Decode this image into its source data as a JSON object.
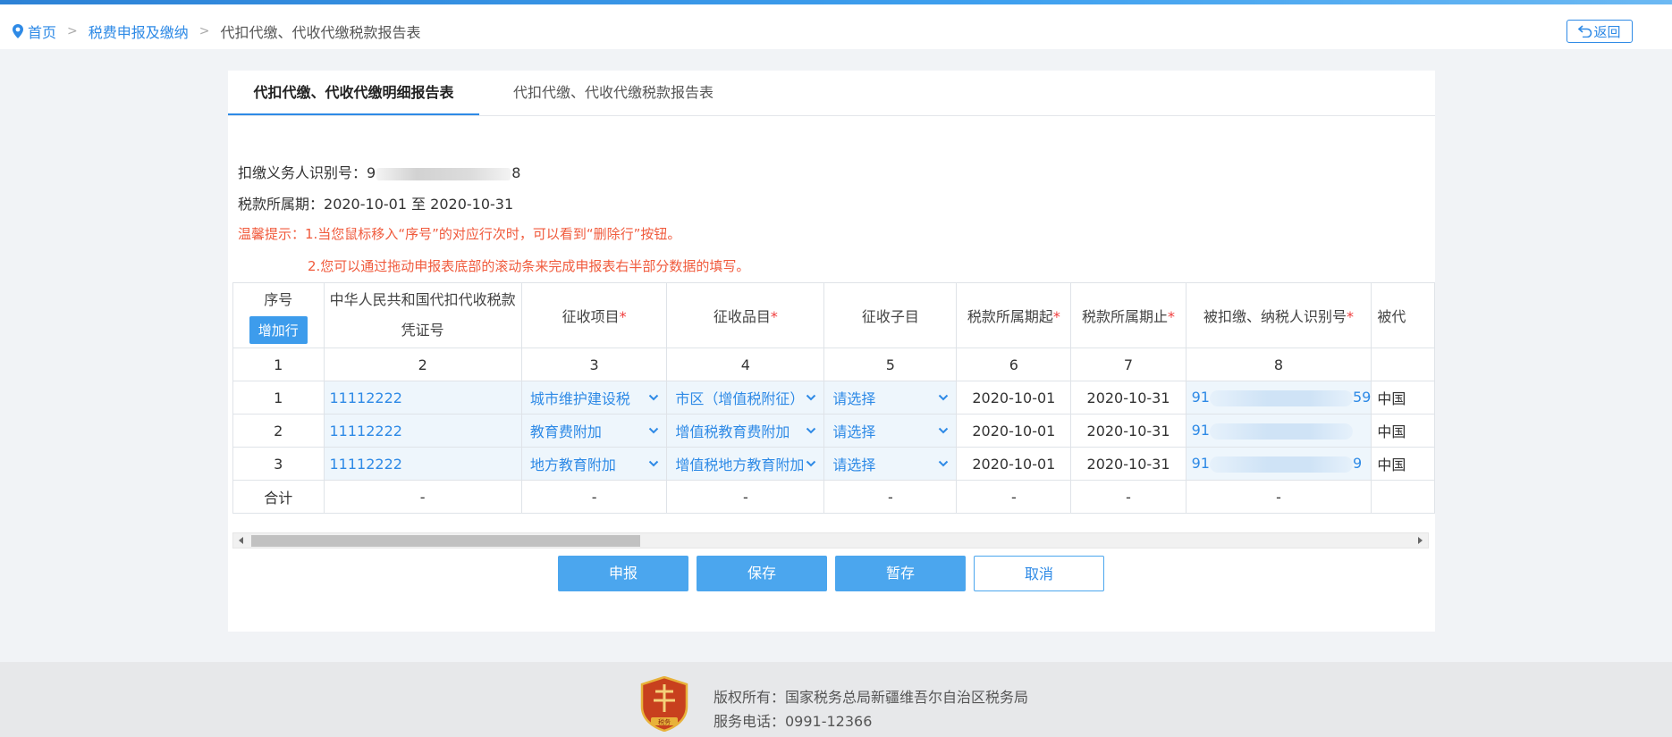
{
  "breadcrumb": {
    "home": "首页",
    "level1": "税费申报及缴纳",
    "current": "代扣代缴、代收代缴税款报告表",
    "separator": ">"
  },
  "back_button": {
    "label": "返回",
    "icon": "return-arrow-icon"
  },
  "tabs": [
    {
      "label": "代扣代缴、代收代缴明细报告表",
      "active": true
    },
    {
      "label": "代扣代缴、代收代缴税款报告表",
      "active": false
    }
  ],
  "info": {
    "taxpayer_id_label": "扣缴义务人识别号：",
    "taxpayer_id_prefix": "9",
    "taxpayer_id_suffix": "8",
    "period_label": "税款所属期：",
    "period_value": "2020-10-01 至 2020-10-31",
    "tip1": "温馨提示：1.当您鼠标移入“序号”的对应行次时，可以看到“删除行”按钮。",
    "tip2": "2.您可以通过拖动申报表底部的滚动条来完成申报表右半部分数据的填写。"
  },
  "table": {
    "headers": {
      "seq": "序号",
      "add_row": "增加行",
      "voucher_line1": "中华人民共和国代扣代收税款",
      "voucher_line2": "凭证号",
      "item": "征收项目",
      "subitem": "征收品目",
      "child": "征收子目",
      "start": "税款所属期起",
      "end": "税款所属期止",
      "payer_id": "被扣缴、纳税人识别号",
      "next_partial": "被代",
      "required_mark": "*"
    },
    "col_numbers": [
      "1",
      "2",
      "3",
      "4",
      "5",
      "6",
      "7",
      "8",
      ""
    ],
    "rows": [
      {
        "seq": "1",
        "voucher": "11112222",
        "item": "城市维护建设税",
        "subitem": "市区（增值税附征）",
        "child": "请选择",
        "start": "2020-10-01",
        "end": "2020-10-31",
        "id_prefix": "91",
        "id_suffix": "59",
        "next": "中国"
      },
      {
        "seq": "2",
        "voucher": "11112222",
        "item": "教育费附加",
        "subitem": "增值税教育费附加",
        "child": "请选择",
        "start": "2020-10-01",
        "end": "2020-10-31",
        "id_prefix": "91",
        "id_suffix": "",
        "next": "中国"
      },
      {
        "seq": "3",
        "voucher": "11112222",
        "item": "地方教育附加",
        "subitem": "增值税地方教育附加",
        "child": "请选择",
        "start": "2020-10-01",
        "end": "2020-10-31",
        "id_prefix": "91",
        "id_suffix": "9",
        "next": "中国"
      }
    ],
    "total": {
      "label": "合计",
      "dash": "-"
    }
  },
  "actions": {
    "submit": "申报",
    "save": "保存",
    "draft": "暂存",
    "cancel": "取消"
  },
  "footer": {
    "copyright": "版权所有：国家税务总局新疆维吾尔自治区税务局",
    "phone": "服务电话：0991-12366",
    "emblem_text": "税务"
  },
  "colors": {
    "accent": "#2e8ae6",
    "button_primary": "#4ba6ee",
    "tip_red": "#f05a3c",
    "required_red": "#f03c3c",
    "editable_cell_bg": "#eef6fc"
  }
}
